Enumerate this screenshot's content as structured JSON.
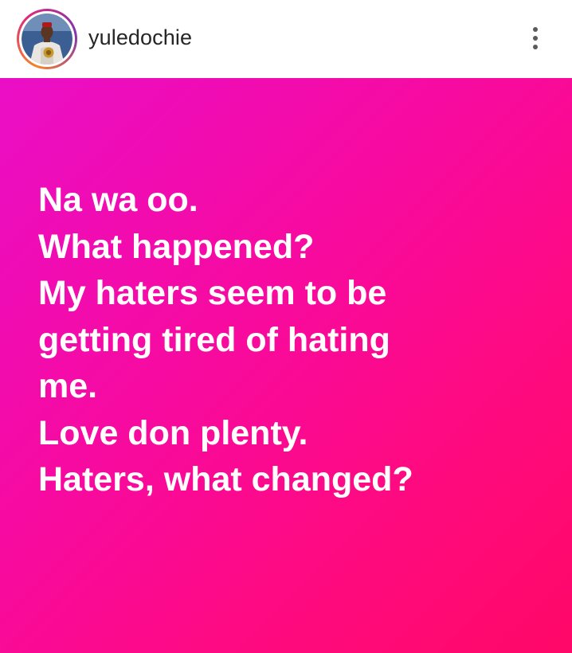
{
  "header": {
    "username": "yuledochie",
    "avatar_icon": "profile-photo",
    "more_icon": "more-vertical-icon",
    "ring_colors": [
      "#f58529",
      "#dd2a7b",
      "#8134af"
    ]
  },
  "post": {
    "background_colors": [
      "#ea0ec6",
      "#ff0868"
    ],
    "text_color": "#ffffff",
    "lines": [
      "Na wa oo.",
      "What happened?",
      "My haters seem to be",
      "getting tired of hating",
      "me.",
      "Love don plenty.",
      "Haters, what changed?"
    ]
  }
}
